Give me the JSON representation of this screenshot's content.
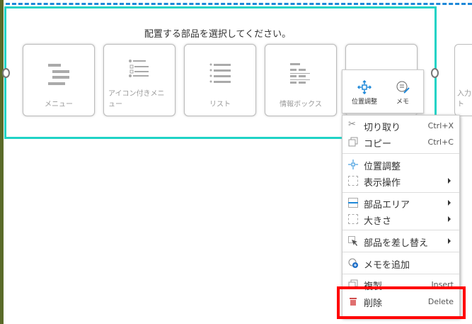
{
  "prompt": "配置する部品を選択してください。",
  "cards": [
    {
      "label": "メニュー"
    },
    {
      "label": "アイコン付きメニュー",
      "line1": "アイコン付きメニ",
      "line2": "ュー"
    },
    {
      "label": "リスト"
    },
    {
      "label": "情報ボックス"
    }
  ],
  "partial_card": {
    "line1": "入力",
    "line2": "ト"
  },
  "mini_toolbar": {
    "position": "位置調整",
    "memo": "メモ"
  },
  "menu": {
    "cut": {
      "label": "切り取り",
      "shortcut": "Ctrl+X"
    },
    "copy": {
      "label": "コピー",
      "shortcut": "Ctrl+C"
    },
    "position": {
      "label": "位置調整"
    },
    "display": {
      "label": "表示操作"
    },
    "area": {
      "label": "部品エリア"
    },
    "size": {
      "label": "大きさ"
    },
    "replace": {
      "label": "部品を差し替え"
    },
    "add_memo": {
      "label": "メモを追加"
    },
    "duplicate": {
      "label": "複製",
      "shortcut": "Insert"
    },
    "delete": {
      "label": "削除",
      "shortcut": "Delete"
    }
  },
  "colors": {
    "accent": "#1fd3c6",
    "highlight": "#ff0000",
    "blue": "#1e88d8"
  }
}
